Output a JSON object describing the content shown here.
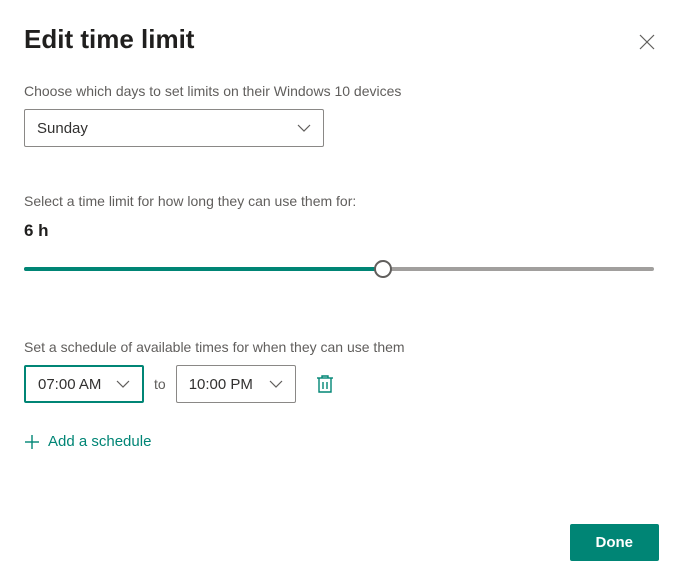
{
  "title": "Edit time limit",
  "section_days": {
    "label": "Choose which days to set limits on their Windows 10 devices",
    "selected": "Sunday"
  },
  "section_limit": {
    "label": "Select a time limit for how long they can use them for:",
    "value_display": "6 h",
    "slider_percent": 57
  },
  "section_schedule": {
    "label": "Set a schedule of available times for when they can use them",
    "from": "07:00 AM",
    "to_word": "to",
    "to": "10:00 PM",
    "add_label": "Add a schedule"
  },
  "done_label": "Done"
}
